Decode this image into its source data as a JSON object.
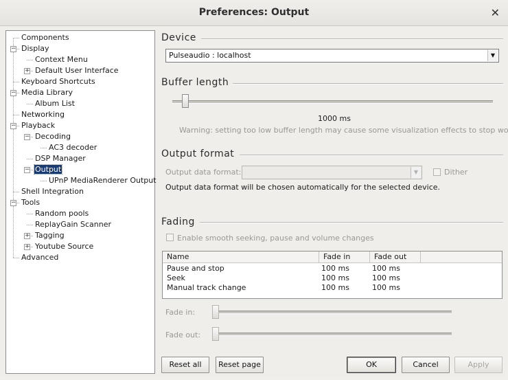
{
  "window": {
    "title": "Preferences: Output",
    "close_glyph": "✕"
  },
  "tree": {
    "items": [
      {
        "label": "Components",
        "level": 0,
        "expander": null
      },
      {
        "label": "Display",
        "level": 0,
        "expander": "minus"
      },
      {
        "label": "Context Menu",
        "level": 1,
        "expander": null
      },
      {
        "label": "Default User Interface",
        "level": 1,
        "expander": "plus"
      },
      {
        "label": "Keyboard Shortcuts",
        "level": 0,
        "expander": null
      },
      {
        "label": "Media Library",
        "level": 0,
        "expander": "minus"
      },
      {
        "label": "Album List",
        "level": 1,
        "expander": null
      },
      {
        "label": "Networking",
        "level": 0,
        "expander": null
      },
      {
        "label": "Playback",
        "level": 0,
        "expander": "minus"
      },
      {
        "label": "Decoding",
        "level": 1,
        "expander": "minus"
      },
      {
        "label": "AC3 decoder",
        "level": 2,
        "expander": null
      },
      {
        "label": "DSP Manager",
        "level": 1,
        "expander": null
      },
      {
        "label": "Output",
        "level": 1,
        "expander": "minus",
        "selected": true
      },
      {
        "label": "UPnP MediaRenderer Output",
        "level": 2,
        "expander": null
      },
      {
        "label": "Shell Integration",
        "level": 0,
        "expander": null
      },
      {
        "label": "Tools",
        "level": 0,
        "expander": "minus"
      },
      {
        "label": "Random pools",
        "level": 1,
        "expander": null
      },
      {
        "label": "ReplayGain Scanner",
        "level": 1,
        "expander": null
      },
      {
        "label": "Tagging",
        "level": 1,
        "expander": "plus"
      },
      {
        "label": "Youtube Source",
        "level": 1,
        "expander": "plus"
      },
      {
        "label": "Advanced",
        "level": 0,
        "expander": null
      }
    ]
  },
  "device": {
    "title": "Device",
    "selected": "Pulseaudio : localhost"
  },
  "buffer": {
    "title": "Buffer length",
    "value_text": "1000 ms",
    "slider_fraction": 0.03,
    "warning": "Warning: setting too low buffer length may cause some visualization effects to stop working."
  },
  "output_format": {
    "title": "Output format",
    "data_format_label": "Output data format:",
    "data_format_value": "",
    "dither_label": "Dither",
    "dither_checked": false,
    "note": "Output data format will be chosen automatically for the selected device."
  },
  "fading": {
    "title": "Fading",
    "enable_label": "Enable smooth seeking, pause and volume changes",
    "enable_checked": false,
    "columns": [
      "Name",
      "Fade in",
      "Fade out"
    ],
    "rows": [
      [
        "Pause and stop",
        "100 ms",
        "100 ms"
      ],
      [
        "Seek",
        "100 ms",
        "100 ms"
      ],
      [
        "Manual track change",
        "100 ms",
        "100 ms"
      ]
    ],
    "fade_in_label": "Fade in:",
    "fade_out_label": "Fade out:",
    "fade_in_fraction": 0.0,
    "fade_out_fraction": 0.0
  },
  "buttons": {
    "reset_all": "Reset all",
    "reset_page": "Reset page",
    "ok": "OK",
    "cancel": "Cancel",
    "apply": "Apply"
  },
  "colors": {
    "selection": "#1a3a72",
    "background": "#efeeea"
  }
}
